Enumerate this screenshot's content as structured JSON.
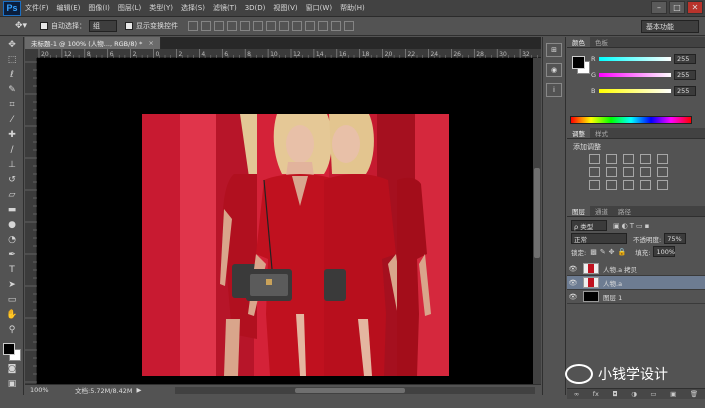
{
  "app": {
    "logo": "Ps"
  },
  "menu": [
    "文件(F)",
    "编辑(E)",
    "图像(I)",
    "图层(L)",
    "类型(Y)",
    "选择(S)",
    "滤镜(T)",
    "3D(D)",
    "视图(V)",
    "窗口(W)",
    "帮助(H)"
  ],
  "options": {
    "auto_select_label": "自动选择：",
    "auto_select_value": "组",
    "show_transform_label": "显示变换控件",
    "workspace": "基本功能"
  },
  "document": {
    "tab_title": "未标题-1 @ 100% (人物..., RGB/8) *",
    "zoom": "100%",
    "doc_info": "文档:5.72M/8.42M",
    "ruler_marks": [
      "20",
      "12",
      "8",
      "6",
      "2",
      "0",
      "2",
      "4",
      "6",
      "8",
      "10",
      "12",
      "14",
      "16",
      "18",
      "20",
      "22",
      "24",
      "26",
      "28",
      "30",
      "32"
    ]
  },
  "color_panel": {
    "tabs": [
      "颜色",
      "色板"
    ],
    "r_label": "R",
    "r_value": "255",
    "g_label": "G",
    "g_value": "255",
    "b_label": "B",
    "b_value": "255"
  },
  "adjust_panel": {
    "tabs": [
      "调整",
      "样式"
    ],
    "title": "添加调整"
  },
  "layers_panel": {
    "tabs": [
      "图层",
      "通道",
      "路径"
    ],
    "kind_filter": "ρ 类型",
    "blend_mode": "正常",
    "opacity_label": "不透明度:",
    "opacity_value": "75%",
    "lock_label": "锁定:",
    "fill_label": "填充:",
    "fill_value": "100%",
    "layers": [
      {
        "name": "人物.a 拷贝",
        "selected": false
      },
      {
        "name": "人物.a",
        "selected": true
      },
      {
        "name": "图层 1",
        "selected": false
      }
    ],
    "footer_icons": [
      "∞",
      "fx",
      "◘",
      "◑",
      "▭",
      "▣",
      "🗑"
    ]
  },
  "watermark": {
    "text": "小钱学设计"
  },
  "colors": {
    "photo_red": "#cf1d35",
    "selected_layer": "#6d7c92"
  }
}
